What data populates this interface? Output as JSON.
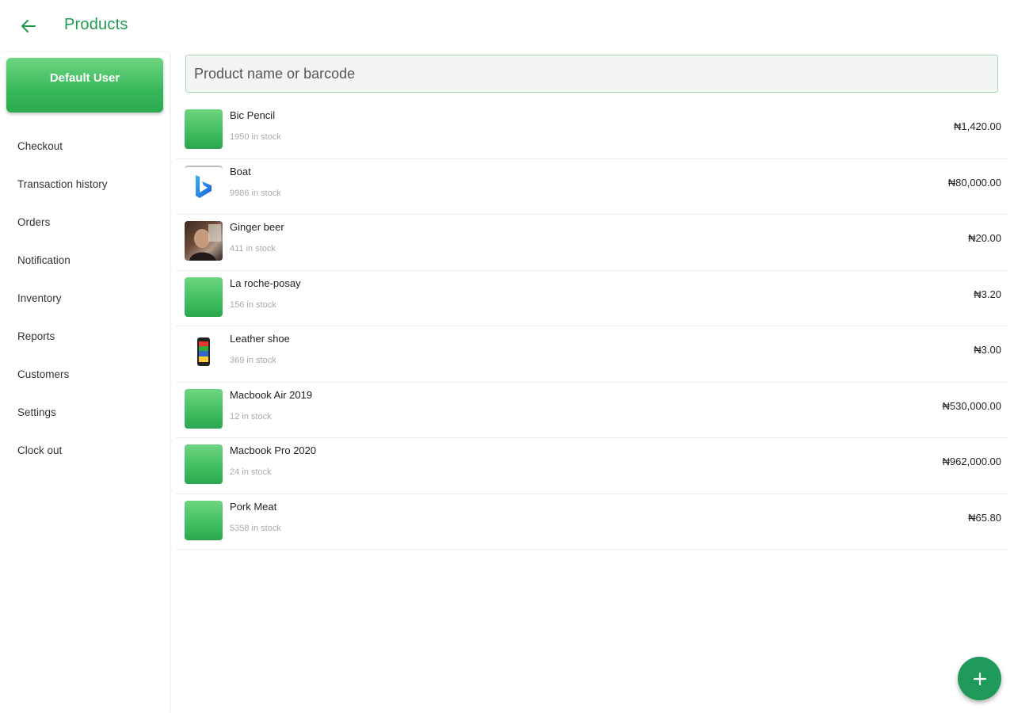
{
  "header": {
    "title": "Products",
    "back_icon": "arrow-left-icon",
    "accent_color": "#1f9a4e"
  },
  "sidebar": {
    "user_label": "Default User",
    "items": [
      {
        "label": "Checkout"
      },
      {
        "label": "Transaction history"
      },
      {
        "label": "Orders"
      },
      {
        "label": "Notification"
      },
      {
        "label": "Inventory"
      },
      {
        "label": "Reports"
      },
      {
        "label": "Customers"
      },
      {
        "label": "Settings"
      },
      {
        "label": "Clock out"
      }
    ]
  },
  "search": {
    "placeholder": "Product name or barcode",
    "value": ""
  },
  "products": [
    {
      "name": "Bic Pencil",
      "stock": "1950 in stock",
      "price": "₦1,420.00",
      "thumb": "green"
    },
    {
      "name": "Boat",
      "stock": "9986 in stock",
      "price": "₦80,000.00",
      "thumb": "bing"
    },
    {
      "name": "Ginger beer",
      "stock": "411 in stock",
      "price": "₦20.00",
      "thumb": "photo"
    },
    {
      "name": "La roche-posay",
      "stock": "156 in stock",
      "price": "₦3.20",
      "thumb": "green"
    },
    {
      "name": "Leather shoe",
      "stock": "369 in stock",
      "price": "₦3.00",
      "thumb": "phone"
    },
    {
      "name": "Macbook Air 2019",
      "stock": "12 in stock",
      "price": "₦530,000.00",
      "thumb": "green"
    },
    {
      "name": "Macbook Pro 2020",
      "stock": "24 in stock",
      "price": "₦962,000.00",
      "thumb": "green"
    },
    {
      "name": "Pork Meat",
      "stock": "5358 in stock",
      "price": "₦65.80",
      "thumb": "green"
    }
  ],
  "fab": {
    "icon": "plus-icon",
    "color": "#1f9a5a"
  }
}
